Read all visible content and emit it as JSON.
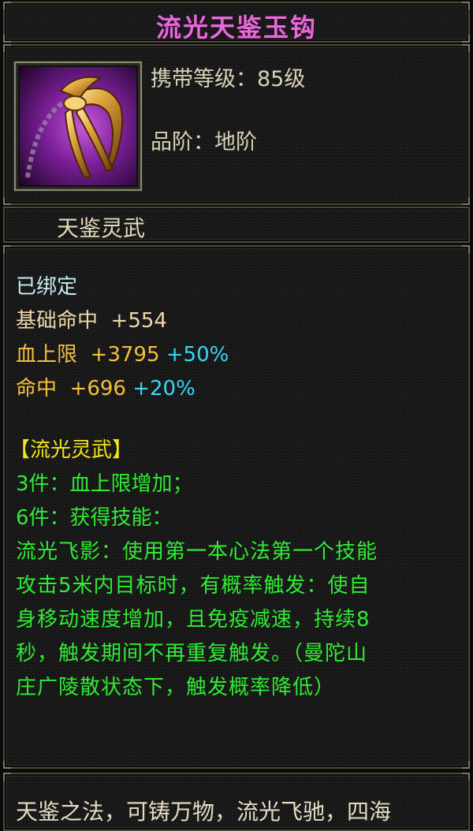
{
  "item": {
    "name": "流光天鉴玉钩",
    "carry_level": "携带等级：85级",
    "grade": "品阶：地阶",
    "category": "天鉴灵武"
  },
  "colors": {
    "name": "#e46ad8",
    "bound": "#c8ecf2",
    "base_stat": "#f0d7ad",
    "stat": "#f4c03e",
    "percent": "#38d7f6",
    "set_name": "#f4e51b",
    "set_effect": "#2fec34"
  },
  "icon": "golden-claw-hook-icon",
  "status": {
    "bound": "已绑定"
  },
  "stats": [
    {
      "name": "基础命中",
      "value": "+554"
    },
    {
      "name": "血上限",
      "value": "+3795",
      "bonus": "+50%"
    },
    {
      "name": "命中",
      "value": "+696",
      "bonus": "+20%"
    }
  ],
  "set": {
    "title": "【流光灵武】",
    "bonus_3": "3件：血上限增加；",
    "bonus_6": "6件：获得技能：",
    "description_lines": [
      "流光飞影：使用第一本心法第一个技能",
      "攻击5米内目标时，有概率触发：使自",
      "身移动速度增加，且免疫减速，持续8",
      "秒，触发期间不再重复触发。（曼陀山",
      "庄广陵散状态下，触发概率降低）"
    ]
  },
  "lore": "天鉴之法，可铸万物，流光飞驰，四海"
}
